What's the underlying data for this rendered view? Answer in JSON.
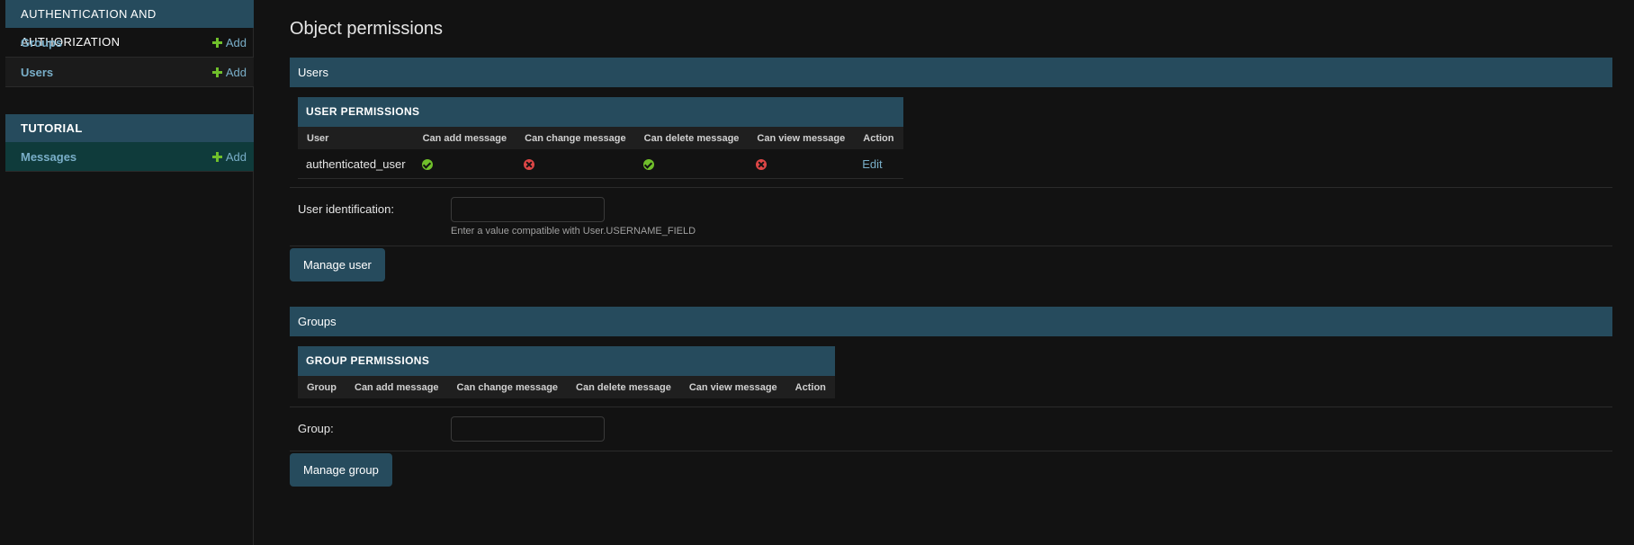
{
  "sidebar": {
    "modules": [
      {
        "caption": "Authentication and Authorization",
        "items": [
          {
            "label": "Groups",
            "add_label": "Add"
          },
          {
            "label": "Users",
            "add_label": "Add"
          }
        ]
      },
      {
        "caption": "Tutorial",
        "items": [
          {
            "label": "Messages",
            "add_label": "Add"
          }
        ]
      }
    ]
  },
  "main": {
    "title": "Object permissions",
    "users_section": {
      "header": "Users",
      "table_caption": "User permissions",
      "columns": [
        "User",
        "Can add message",
        "Can change message",
        "Can delete message",
        "Can view message",
        "Action"
      ],
      "rows": [
        {
          "name": "authenticated_user",
          "add": true,
          "change": false,
          "delete": true,
          "view": false,
          "action": "Edit"
        }
      ],
      "field_label": "User identification:",
      "field_value": "",
      "field_help": "Enter a value compatible with User.USERNAME_FIELD",
      "button": "Manage user"
    },
    "groups_section": {
      "header": "Groups",
      "table_caption": "Group permissions",
      "columns": [
        "Group",
        "Can add message",
        "Can change message",
        "Can delete message",
        "Can view message",
        "Action"
      ],
      "field_label": "Group:",
      "field_value": "",
      "button": "Manage group"
    }
  },
  "colors": {
    "header_bg": "#264b5d",
    "link": "#79aec8",
    "yes": "#70bf2b",
    "no": "#dd4646",
    "page_bg": "#121212"
  }
}
